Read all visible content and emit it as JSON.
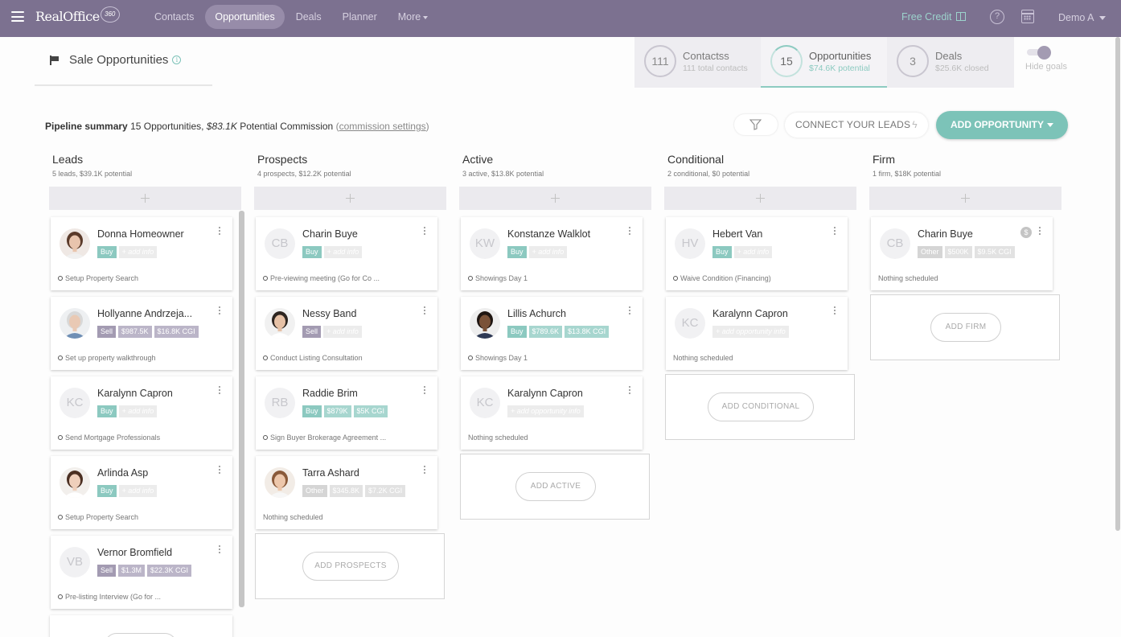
{
  "nav": {
    "logo": "RealOffice",
    "logo_badge": "360",
    "items": [
      "Contacts",
      "Opportunities",
      "Deals",
      "Planner",
      "More"
    ],
    "free_credit": "Free Credit",
    "user": "Demo A"
  },
  "page": {
    "title": "Sale Opportunities",
    "info": "i"
  },
  "goals": [
    {
      "count": "111",
      "title": "Contactss",
      "sub": "111 total contacts"
    },
    {
      "count": "15",
      "title": "Opportunities",
      "sub": "$74.6K potential"
    },
    {
      "count": "3",
      "title": "Deals",
      "sub": "$25.6K closed"
    }
  ],
  "hide_goals": "Hide goals",
  "summary": {
    "label": "Pipeline summary",
    "opps": "15 Opportunities,",
    "amount": "$83.1K",
    "commission": "Potential Commission",
    "paren_open": "(",
    "link": "commission settings",
    "paren_close": ")"
  },
  "actions": {
    "connect": "CONNECT YOUR LEADS",
    "add_opportunity": "ADD OPPORTUNITY"
  },
  "columns": [
    {
      "title": "Leads",
      "sub": "5 leads, $39.1K potential",
      "cards": [
        {
          "name": "Donna Homeowner",
          "avatar": "photo",
          "tags": [
            {
              "t": "Buy",
              "c": "buy"
            },
            {
              "t": "+ add info",
              "c": "addinfo"
            }
          ],
          "task": "Setup Property Search",
          "has_task": true
        },
        {
          "name": "Hollyanne Andrzeja...",
          "avatar": "photo",
          "tags": [
            {
              "t": "Sell",
              "c": "sell"
            },
            {
              "t": "$987.5K",
              "c": "val-purple"
            },
            {
              "t": "$16.8K CGI",
              "c": "val-purple"
            }
          ],
          "task": "Set up property walkthrough",
          "has_task": true
        },
        {
          "name": "Karalynn Capron",
          "avatar": "KC",
          "tags": [
            {
              "t": "Buy",
              "c": "buy"
            },
            {
              "t": "+ add info",
              "c": "addinfo"
            }
          ],
          "task": "Send Mortgage Professionals",
          "has_task": true
        },
        {
          "name": "Arlinda Asp",
          "avatar": "photo",
          "tags": [
            {
              "t": "Buy",
              "c": "buy"
            },
            {
              "t": "+ add info",
              "c": "addinfo"
            }
          ],
          "task": "Setup Property Search",
          "has_task": true
        },
        {
          "name": "Vernor Bromfield",
          "avatar": "VB",
          "tags": [
            {
              "t": "Sell",
              "c": "sell"
            },
            {
              "t": "$1.3M",
              "c": "val-purple"
            },
            {
              "t": "$22.3K CGI",
              "c": "val-purple"
            }
          ],
          "task": "Pre-listing Interview (Go for ...",
          "has_task": true
        }
      ]
    },
    {
      "title": "Prospects",
      "sub": "4 prospects, $12.2K potential",
      "cards": [
        {
          "name": "Charin Buye",
          "avatar": "CB",
          "tags": [
            {
              "t": "Buy",
              "c": "buy"
            },
            {
              "t": "+ add info",
              "c": "addinfo"
            }
          ],
          "task": "Pre-viewing meeting (Go for Co ...",
          "has_task": true
        },
        {
          "name": "Nessy Band",
          "avatar": "photo",
          "tags": [
            {
              "t": "Sell",
              "c": "sell"
            },
            {
              "t": "+ add info",
              "c": "addinfo"
            }
          ],
          "task": "Conduct Listing Consultation",
          "has_task": true
        },
        {
          "name": "Raddie Brim",
          "avatar": "RB",
          "tags": [
            {
              "t": "Buy",
              "c": "buy"
            },
            {
              "t": "$879K",
              "c": "val-teal"
            },
            {
              "t": "$5K CGI",
              "c": "val-teal"
            }
          ],
          "task": "Sign Buyer Brokerage Agreement ...",
          "has_task": true
        },
        {
          "name": "Tarra Ashard",
          "avatar": "photo",
          "tags": [
            {
              "t": "Other",
              "c": "other"
            },
            {
              "t": "$345.8K",
              "c": "val-grey"
            },
            {
              "t": "$7.2K CGI",
              "c": "val-grey"
            }
          ],
          "task": "Nothing scheduled",
          "has_task": false
        }
      ],
      "add_label": "ADD PROSPECTS"
    },
    {
      "title": "Active",
      "sub": "3 active, $13.8K potential",
      "cards": [
        {
          "name": "Konstanze Walklot",
          "avatar": "KW",
          "tags": [
            {
              "t": "Buy",
              "c": "buy"
            },
            {
              "t": "+ add info",
              "c": "addinfo"
            }
          ],
          "task": "Showings Day 1",
          "has_task": true
        },
        {
          "name": "Lillis Achurch",
          "avatar": "photo",
          "tags": [
            {
              "t": "Buy",
              "c": "buy"
            },
            {
              "t": "$789.6K",
              "c": "val-teal"
            },
            {
              "t": "$13.8K CGI",
              "c": "val-teal"
            }
          ],
          "task": "Showings Day 1",
          "has_task": true
        },
        {
          "name": "Karalynn Capron",
          "avatar": "KC",
          "tags": [
            {
              "t": "+ add opportunity info",
              "c": "addinfo"
            }
          ],
          "task": "Nothing scheduled",
          "has_task": false
        }
      ],
      "add_label": "ADD ACTIVE"
    },
    {
      "title": "Conditional",
      "sub": "2 conditional, $0 potential",
      "cards": [
        {
          "name": "Hebert Van",
          "avatar": "HV",
          "tags": [
            {
              "t": "Buy",
              "c": "buy"
            },
            {
              "t": "+ add info",
              "c": "addinfo"
            }
          ],
          "task": "Waive Condition (Financing)",
          "has_task": true
        },
        {
          "name": "Karalynn Capron",
          "avatar": "KC",
          "tags": [
            {
              "t": "+ add opportunity info",
              "c": "addinfo"
            }
          ],
          "task": "Nothing scheduled",
          "has_task": false
        }
      ],
      "add_label": "ADD CONDITIONAL"
    },
    {
      "title": "Firm",
      "sub": "1 firm, $18K potential",
      "cards": [
        {
          "name": "Charin Buye",
          "avatar": "CB",
          "tags": [
            {
              "t": "Other",
              "c": "other"
            },
            {
              "t": "$500K",
              "c": "val-grey"
            },
            {
              "t": "$9.5K CGI",
              "c": "val-grey"
            }
          ],
          "task": "Nothing scheduled",
          "has_task": false,
          "dollar": "$"
        }
      ],
      "add_label": "ADD FIRM"
    }
  ],
  "colors": {
    "topbar": "#7c7190",
    "accent": "#7cc3b8",
    "buy": "#8cc9c0",
    "sell": "#a39bb2"
  }
}
